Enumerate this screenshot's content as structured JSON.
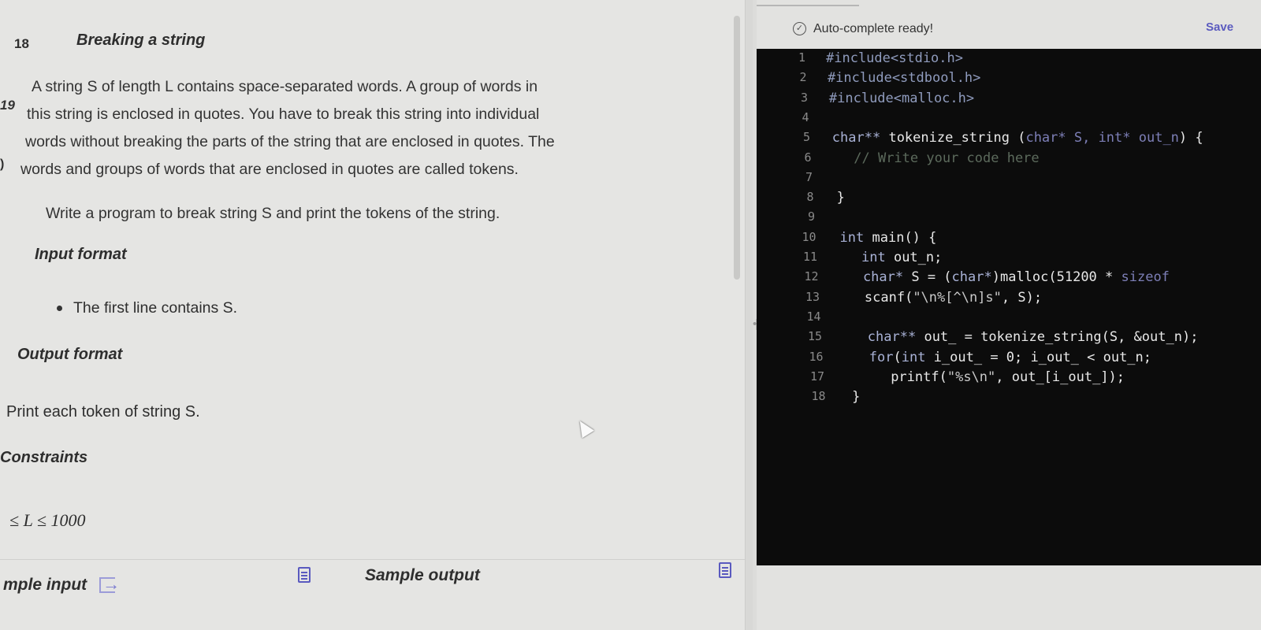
{
  "problem": {
    "number": "18",
    "number_next": "19",
    "edge_mark": ")",
    "title": "Breaking a string",
    "paragraph1_lines": [
      "A string S of length L contains space-separated words. A group of words in",
      "this string is enclosed in quotes. You have to break this string into individual",
      "words without breaking the parts of the string that are enclosed in quotes. The",
      "words and groups of words that are enclosed in quotes are called tokens."
    ],
    "paragraph2": "Write a program to break string S and print the tokens of the string.",
    "input_heading": "Input format",
    "input_bullet": "The first line contains S.",
    "output_heading": "Output format",
    "output_text": "Print each token of string S.",
    "constraints_heading": "Constraints",
    "constraint": "≤ L ≤ 1000",
    "sample_input_label": "mple input",
    "sample_output_label": "Sample output"
  },
  "editor": {
    "status": "Auto-complete ready!",
    "save_label": "Save",
    "resize_glyph": "•||•",
    "lines": [
      {
        "n": "1",
        "indent": 0,
        "parts": [
          [
            "inc",
            "#include<stdio.h>"
          ]
        ]
      },
      {
        "n": "2",
        "indent": 0,
        "parts": [
          [
            "inc",
            "#include<stdbool.h>"
          ]
        ]
      },
      {
        "n": "3",
        "indent": 0,
        "parts": [
          [
            "inc",
            "#include<malloc.h>"
          ]
        ]
      },
      {
        "n": "4",
        "indent": 0,
        "parts": []
      },
      {
        "n": "5",
        "indent": 0,
        "parts": [
          [
            "kw",
            "char** "
          ],
          [
            "",
            "tokenize_string ("
          ],
          [
            "sh",
            "char* S, int* out_n"
          ],
          [
            "",
            ") {"
          ]
        ]
      },
      {
        "n": "6",
        "indent": 2,
        "parts": [
          [
            "cm",
            "// Write your code here"
          ]
        ]
      },
      {
        "n": "7",
        "indent": 0,
        "parts": []
      },
      {
        "n": "8",
        "indent": 0,
        "parts": [
          [
            "",
            "}"
          ]
        ]
      },
      {
        "n": "9",
        "indent": 0,
        "parts": []
      },
      {
        "n": "10",
        "indent": 0,
        "parts": [
          [
            "kw",
            "int "
          ],
          [
            "",
            "main() {"
          ]
        ]
      },
      {
        "n": "11",
        "indent": 2,
        "parts": [
          [
            "kw",
            "int "
          ],
          [
            "",
            "out_n;"
          ]
        ]
      },
      {
        "n": "12",
        "indent": 2,
        "parts": [
          [
            "kw",
            "char* "
          ],
          [
            "",
            "S = ("
          ],
          [
            "kw",
            "char*"
          ],
          [
            "",
            ")malloc(51200 * "
          ],
          [
            "sh",
            "sizeof"
          ]
        ]
      },
      {
        "n": "13",
        "indent": 2,
        "parts": [
          [
            "",
            "scanf("
          ],
          [
            "str",
            "\"\\n%[^\\n]s\""
          ],
          [
            "",
            ", S);"
          ]
        ]
      },
      {
        "n": "14",
        "indent": 0,
        "parts": []
      },
      {
        "n": "15",
        "indent": 2,
        "parts": [
          [
            "kw",
            "char** "
          ],
          [
            "",
            "out_ = tokenize_string(S, &out_n);"
          ]
        ]
      },
      {
        "n": "16",
        "indent": 2,
        "parts": [
          [
            "kw",
            "for"
          ],
          [
            "",
            "("
          ],
          [
            "kw",
            "int "
          ],
          [
            "",
            "i_out_ = 0; i_out_ < out_n;"
          ]
        ]
      },
      {
        "n": "17",
        "indent": 4,
        "parts": [
          [
            "",
            "printf("
          ],
          [
            "str",
            "\"%s\\n\""
          ],
          [
            "",
            ", out_[i_out_]);"
          ]
        ]
      },
      {
        "n": "18",
        "indent": 0,
        "parts": [
          [
            "",
            "}"
          ]
        ]
      }
    ]
  },
  "colors": {
    "editor_bg": "#0c0c0c",
    "accent": "#5b5bbf",
    "panel_bg": "#e5e5e3"
  }
}
